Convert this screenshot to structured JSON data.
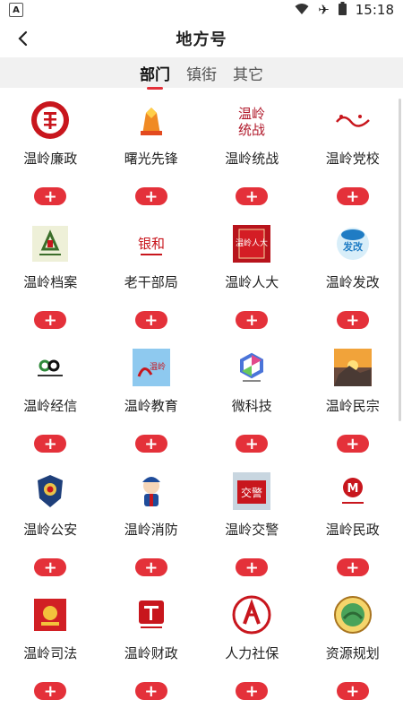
{
  "status": {
    "time": "15:18",
    "left_icon": "notification-a-icon"
  },
  "header": {
    "title": "地方号"
  },
  "tabs": [
    {
      "label": "部门",
      "active": true
    },
    {
      "label": "镇街",
      "active": false
    },
    {
      "label": "其它",
      "active": false
    }
  ],
  "add_label": "+",
  "colors": {
    "accent": "#e4313a",
    "tab_bg": "#f1f1f1"
  },
  "channels": [
    {
      "name": "温岭廉政",
      "icon": "lianzheng-logo-icon"
    },
    {
      "name": "曙光先锋",
      "icon": "shuguang-logo-icon"
    },
    {
      "name": "温岭统战",
      "icon": "tongzhan-logo-icon"
    },
    {
      "name": "温岭党校",
      "icon": "dangxiao-logo-icon"
    },
    {
      "name": "温岭档案",
      "icon": "dangan-logo-icon"
    },
    {
      "name": "老干部局",
      "icon": "laoganbu-logo-icon"
    },
    {
      "name": "温岭人大",
      "icon": "renda-logo-icon"
    },
    {
      "name": "温岭发改",
      "icon": "fagai-logo-icon"
    },
    {
      "name": "温岭经信",
      "icon": "jingxin-logo-icon"
    },
    {
      "name": "温岭教育",
      "icon": "jiaoyu-logo-icon"
    },
    {
      "name": "微科技",
      "icon": "keji-logo-icon"
    },
    {
      "name": "温岭民宗",
      "icon": "minzong-logo-icon"
    },
    {
      "name": "温岭公安",
      "icon": "police-badge-icon"
    },
    {
      "name": "温岭消防",
      "icon": "firefighter-icon"
    },
    {
      "name": "温岭交警",
      "icon": "jiaojing-logo-icon"
    },
    {
      "name": "温岭民政",
      "icon": "minzheng-logo-icon"
    },
    {
      "name": "温岭司法",
      "icon": "sifa-emblem-icon"
    },
    {
      "name": "温岭财政",
      "icon": "caizheng-logo-icon"
    },
    {
      "name": "人力社保",
      "icon": "shebao-logo-icon"
    },
    {
      "name": "资源规划",
      "icon": "ziyuan-logo-icon"
    }
  ]
}
